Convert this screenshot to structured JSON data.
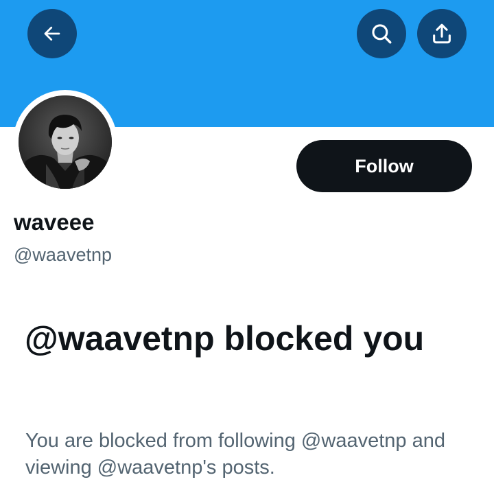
{
  "header": {
    "banner_color": "#1d9bf0",
    "back_icon": "arrow-left-icon",
    "search_icon": "search-icon",
    "share_icon": "share-upload-icon"
  },
  "profile": {
    "display_name": "waveee",
    "handle": "@waavetnp",
    "follow_label": "Follow"
  },
  "blocked_notice": {
    "title": "@waavetnp blocked you",
    "description": "You are blocked from following @waavetnp and viewing @waavetnp's posts."
  }
}
